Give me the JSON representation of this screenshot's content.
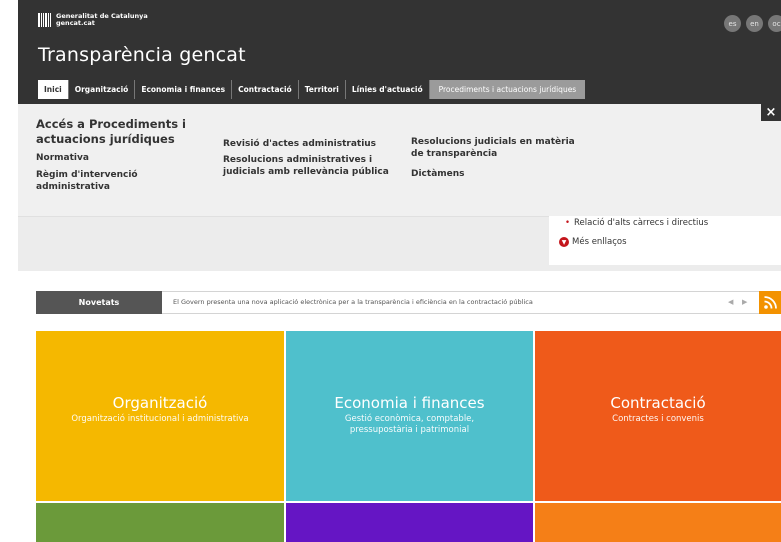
{
  "brand": {
    "line1": "Generalitat de Catalunya",
    "line2": "gencat.cat"
  },
  "site_title": "Transparència gencat",
  "languages": [
    "es",
    "en",
    "oc"
  ],
  "nav": {
    "tabs": [
      "Inici",
      "Organització",
      "Economia i finances",
      "Contractació",
      "Territori",
      "Línies d'actuació"
    ],
    "open_tab": "Procediments i actuacions jurídiques"
  },
  "mega": {
    "close": "×",
    "access_line1": "Accés a Procediments i",
    "access_line2": "actuacions jurídiques",
    "normativa": "Normativa",
    "regim_line1": "Règim d'intervenció",
    "regim_line2": "administrativa",
    "revisio": "Revisió d'actes administratius",
    "resol_admin_line1": "Resolucions administratives i",
    "resol_admin_line2": "judicials amb rellevància pública",
    "resol_jud_line1": "Resolucions judicials en matèria",
    "resol_jud_line2": "de transparència",
    "dictamens": "Dictàmens"
  },
  "links_box": {
    "bullet": "•",
    "relacio": "Relació d'alts càrrecs i directius",
    "more_icon": "chevron-down-icon",
    "more": "Més enllaços"
  },
  "ticker": {
    "label": "Novetats",
    "text": "El Govern presenta una nova aplicació electrònica per a la transparència i eficiència en la contractació pública",
    "prev": "◀",
    "next": "▶"
  },
  "tiles": [
    {
      "title": "Organització",
      "subtitle": "Organització institucional i administrativa",
      "color": "#f5b800"
    },
    {
      "title": "Economia i finances",
      "subtitle_line1": "Gestió econòmica, comptable,",
      "subtitle_line2": "pressupostària i patrimonial",
      "color": "#4fc0cc"
    },
    {
      "title": "Contractació",
      "subtitle": "Contractes i convenis",
      "color": "#ef5a1a"
    }
  ],
  "bottom_tile_colors": [
    "#6b9a3a",
    "#6515c4",
    "#f57f17"
  ]
}
